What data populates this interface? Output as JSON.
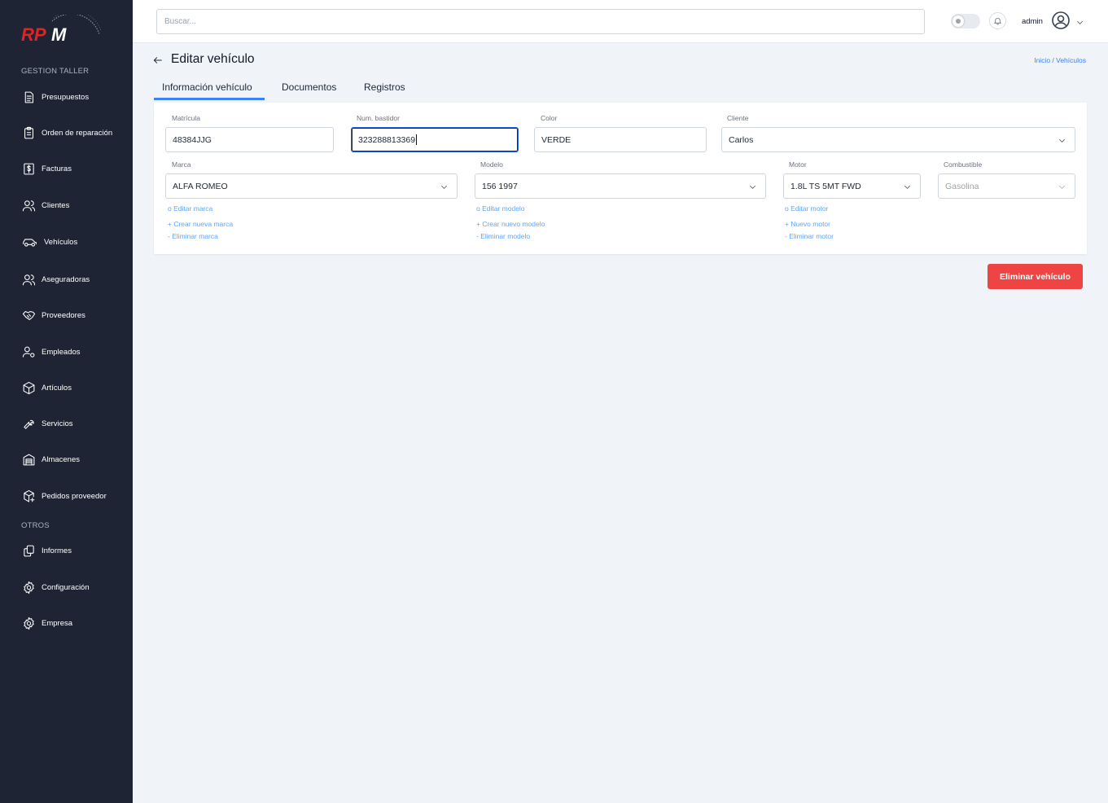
{
  "app": {
    "logo_text": "RPM"
  },
  "sidebar": {
    "section_gestion": "GESTION TALLER",
    "section_otros": "OTROS",
    "items": [
      {
        "label": "Presupuestos",
        "icon": "document-icon"
      },
      {
        "label": "Orden de reparación",
        "icon": "clipboard-icon"
      },
      {
        "label": "Facturas",
        "icon": "invoice-dollar-icon"
      },
      {
        "label": "Clientes",
        "icon": "users-icon"
      },
      {
        "label": "Vehículos",
        "icon": "car-icon"
      },
      {
        "label": "Aseguradoras",
        "icon": "users-icon"
      },
      {
        "label": "Proveedores",
        "icon": "handshake-icon"
      },
      {
        "label": "Empleados",
        "icon": "user-settings-icon"
      },
      {
        "label": "Artículos",
        "icon": "box-icon"
      },
      {
        "label": "Servicios",
        "icon": "wrench-icon"
      },
      {
        "label": "Almacenes",
        "icon": "warehouse-icon"
      },
      {
        "label": "Pedidos proveedor",
        "icon": "package-add-icon"
      }
    ],
    "other_items": [
      {
        "label": "Informes",
        "icon": "copy-icon"
      },
      {
        "label": "Configuración",
        "icon": "gear-icon"
      },
      {
        "label": "Empresa",
        "icon": "gear-icon"
      }
    ]
  },
  "topbar": {
    "search_placeholder": "Buscar...",
    "user_name": "admin"
  },
  "header": {
    "title": "Editar vehículo",
    "breadcrumb": "Inicio  / Vehículos"
  },
  "tabs": [
    {
      "label": "Información vehículo",
      "active": true
    },
    {
      "label": "Documentos",
      "active": false
    },
    {
      "label": "Registros",
      "active": false
    }
  ],
  "form": {
    "matricula": {
      "label": "Matrícula",
      "value": "48384JJG"
    },
    "bastidor": {
      "label": "Num. bastidor",
      "value": "323288813369"
    },
    "color": {
      "label": "Color",
      "value": "VERDE"
    },
    "cliente": {
      "label": "Cliente",
      "value": "Carlos"
    },
    "marca": {
      "label": "Marca",
      "value": "ALFA ROMEO"
    },
    "modelo": {
      "label": "Modelo",
      "value": "156 1997"
    },
    "motor": {
      "label": "Motor",
      "value": "1.8L TS 5MT FWD"
    },
    "combustible": {
      "label": "Combustible",
      "value": "Gasolina"
    },
    "marca_links": {
      "edit": "o Editar marca",
      "create": "+ Crear nueva marca",
      "delete": "- Eliminar marca"
    },
    "modelo_links": {
      "edit": "o Editar modelo",
      "create": "+ Crear nuevo modelo",
      "delete": "- Eliminar modelo"
    },
    "motor_links": {
      "edit": "o Editar motor",
      "create": "+ Nuevo motor",
      "delete": "- Eliminar motor"
    }
  },
  "actions": {
    "delete_label": "Eliminar vehículo"
  },
  "colors": {
    "sidebar_bg": "#1e2433",
    "accent": "#3b82f6",
    "danger": "#ef4444",
    "page_bg": "#f0f3f8"
  }
}
